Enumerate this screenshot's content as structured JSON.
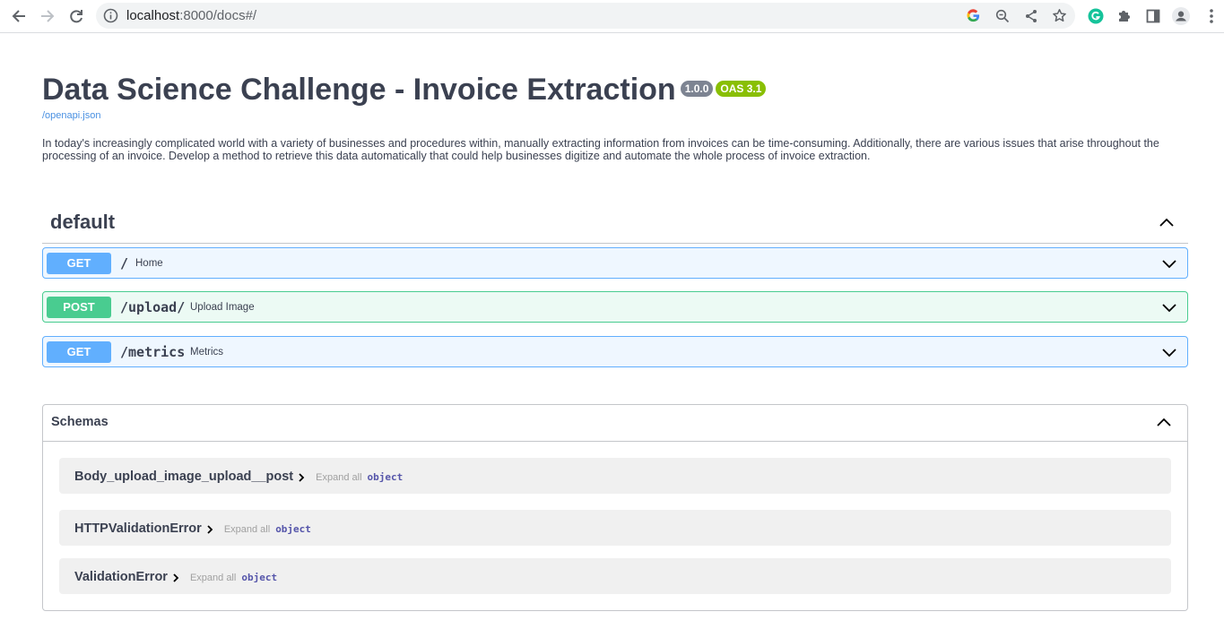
{
  "browser": {
    "url_host": "localhost",
    "url_rest": ":8000/docs#/"
  },
  "page": {
    "title": "Data Science Challenge - Invoice Extraction",
    "version_badge": "1.0.0",
    "oas_badge": "OAS 3.1",
    "spec_link": "/openapi.json",
    "description": "In today's increasingly complicated world with a variety of businesses and procedures within, manually extracting information from invoices can be time-consuming. Additionally, there are various issues that arise throughout the processing of an invoice. Develop a method to retrieve this data automatically that could help businesses digitize and automate the whole process of invoice extraction."
  },
  "section": {
    "title": "default",
    "operations": [
      {
        "method": "GET",
        "path": "/",
        "summary": "Home"
      },
      {
        "method": "POST",
        "path": "/upload/",
        "summary": "Upload Image"
      },
      {
        "method": "GET",
        "path": "/metrics",
        "summary": "Metrics"
      }
    ]
  },
  "schemas": {
    "title": "Schemas",
    "models": [
      {
        "name": "Body_upload_image_upload__post",
        "expand": "Expand all",
        "type": "object"
      },
      {
        "name": "HTTPValidationError",
        "expand": "Expand all",
        "type": "object"
      },
      {
        "name": "ValidationError",
        "expand": "Expand all",
        "type": "object"
      }
    ]
  },
  "colors": {
    "get": "#61affe",
    "post": "#49cc90",
    "link": "#4990e2",
    "version_badge": "#7d8492",
    "oas_badge": "#89bf04"
  }
}
